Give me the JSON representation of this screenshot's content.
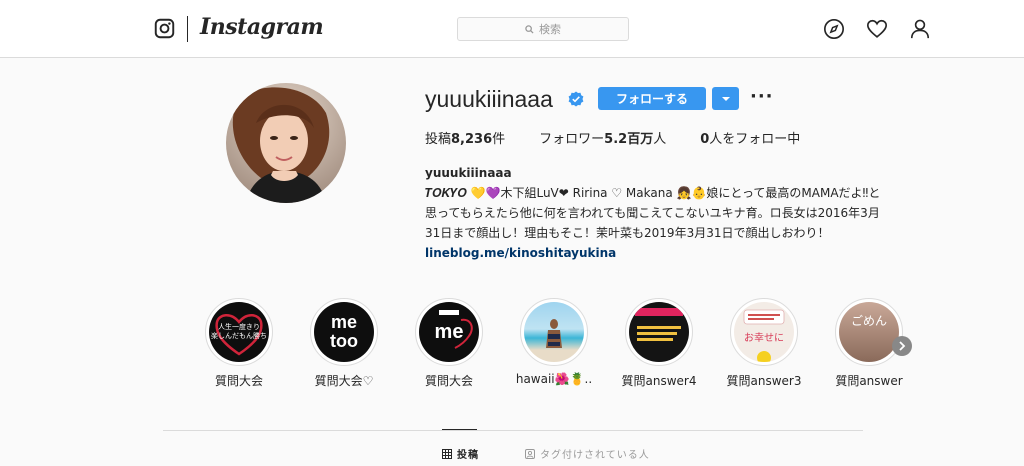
{
  "header": {
    "logo_text": "Instagram",
    "search_placeholder": "検索",
    "icons": [
      "instagram-logo-icon",
      "search-icon",
      "compass-icon",
      "heart-icon",
      "person-icon"
    ]
  },
  "profile": {
    "username": "yuuukiiinaaa",
    "follow_label": "フォローする",
    "stats": {
      "posts_label": "投稿",
      "posts_value": "8,236",
      "posts_unit": "件",
      "followers_label": "フォロワー",
      "followers_value": "5.2百万",
      "followers_unit": "人",
      "following_value": "0",
      "following_text": "人をフォロー中"
    },
    "bio": {
      "name": "yuuukiiinaaa",
      "line1": "𝑻𝑶𝑲𝒀𝑶 💛💜木下組LuV❤ Ririna ♡ Makana 👧👶娘にとって最高のMAMAだよ‼と",
      "line2": "思ってもらえたら他に何を言われても聞こえてこないユキナ育。ロ長女は2016年3月",
      "line3": "31日まで顔出し！理由もそこ！茉叶菜も2019年3月31日で顔出しおわり！",
      "link": "lineblog.me/kinoshitayukina"
    }
  },
  "highlights": [
    {
      "label": "質問大会",
      "image_text": "人生一度きり\n楽しんだもん勝ち"
    },
    {
      "label": "質問大会♡",
      "image_text": "me\ntoo"
    },
    {
      "label": "質問大会",
      "image_text": "me"
    },
    {
      "label": "hawaii🌺🍍..",
      "image_text": ""
    },
    {
      "label": "質問answer4",
      "image_text": ""
    },
    {
      "label": "質問answer3",
      "image_text": "お幸せに"
    },
    {
      "label": "質問answer",
      "image_text": "ごめん"
    }
  ],
  "tabs": {
    "posts_label": "投稿",
    "tagged_label": "タグ付けされている人"
  },
  "colors": {
    "accent": "#3897f0",
    "link": "#003569",
    "verified": "#3897f0"
  }
}
